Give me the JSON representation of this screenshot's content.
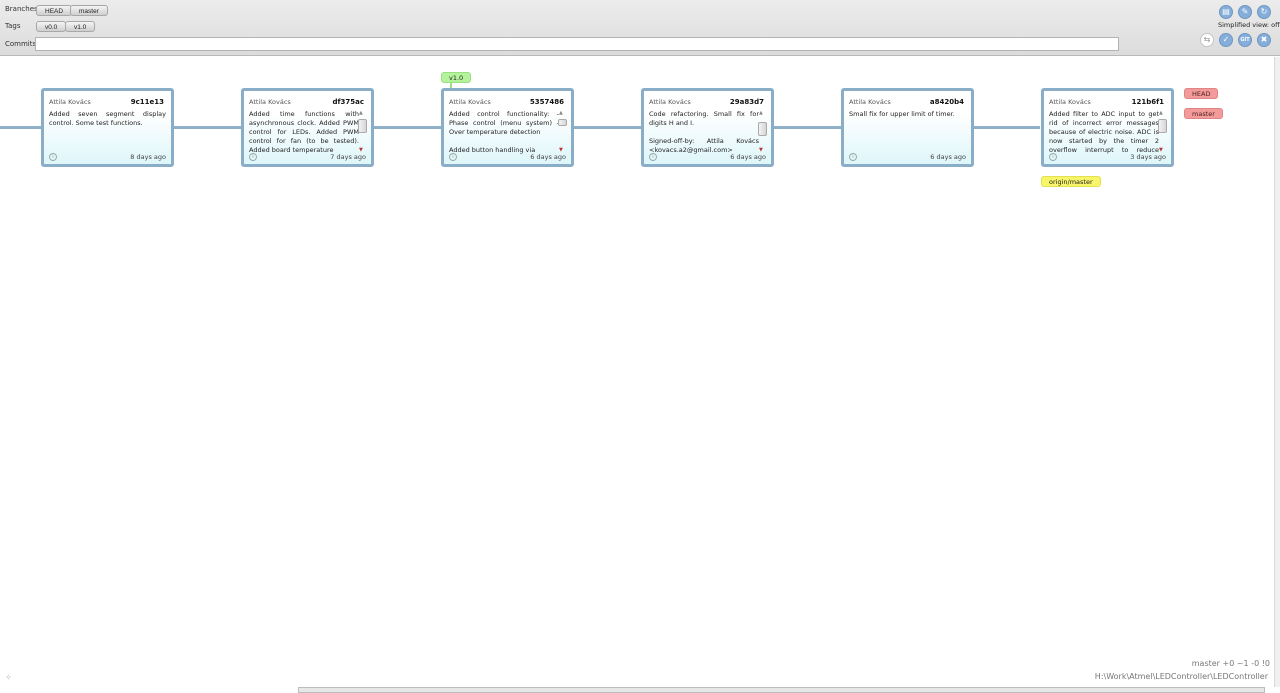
{
  "header": {
    "branches_label": "Branches",
    "tags_label": "Tags",
    "commits_label": "Commits",
    "branches": [
      "HEAD",
      "master"
    ],
    "tags": [
      "v0.0",
      "v1.0"
    ],
    "commits_value": "",
    "simplified_view": "Simplified view: off",
    "tool_icons": [
      "save-icon",
      "pin-icon",
      "refresh-icon",
      "swap-icon",
      "check-icon",
      "git-icon",
      "close-icon"
    ],
    "git_label": "GIT"
  },
  "cards": [
    {
      "author": "Attila Kovács",
      "hash": "9c11e13",
      "message": [
        "Added seven segment display control. Some test functions."
      ],
      "date": "8 days ago",
      "scroll": false
    },
    {
      "author": "Attila Kovács",
      "hash": "df375ac",
      "message": [
        "Added time functions with asynchronous clock. Added PWM control for LEDs. Added PWM control for fan (to be tested). Added board temperature"
      ],
      "date": "7 days ago",
      "scroll": true
    },
    {
      "author": "Attila Kovács",
      "hash": "5357486",
      "message": [
        "Added control functionality: - Phase control (menu system) - Over temperature detection",
        "Added button handling via"
      ],
      "date": "6 days ago",
      "scroll": true
    },
    {
      "author": "Attila Kovács",
      "hash": "29a83d7",
      "message": [
        "Code refactoring. Small fix for digits H and I.",
        "Signed-off-by: Attila Kovács <kovacs.a2@gmail.com>"
      ],
      "date": "6 days ago",
      "scroll": true
    },
    {
      "author": "Attila Kovács",
      "hash": "a8420b4",
      "message": [
        "Small fix for upper limit of timer."
      ],
      "date": "6 days ago",
      "scroll": false
    },
    {
      "author": "Attila Kovács",
      "hash": "121b6f1",
      "message": [
        "Added filter to ADC input to get rid of incorrect error messages because of electric noise. ADC is now started by the timer 2 overflow interrupt to reduce number of calls (previously"
      ],
      "date": "3 days ago",
      "scroll": true
    }
  ],
  "labels": {
    "tag_v10": "v1.0",
    "head": "HEAD",
    "master": "master",
    "origin_master": "origin/master"
  },
  "status": {
    "branch_status": "master +0 ~1 -0 !0",
    "path": "H:\\Work\\Atmel\\LEDController\\LEDController"
  },
  "colors": {
    "tag_green": "#b4f39c",
    "branch_red": "#f39b9b",
    "remote_yellow": "#f7f56a",
    "card_border": "#8aaec7"
  }
}
